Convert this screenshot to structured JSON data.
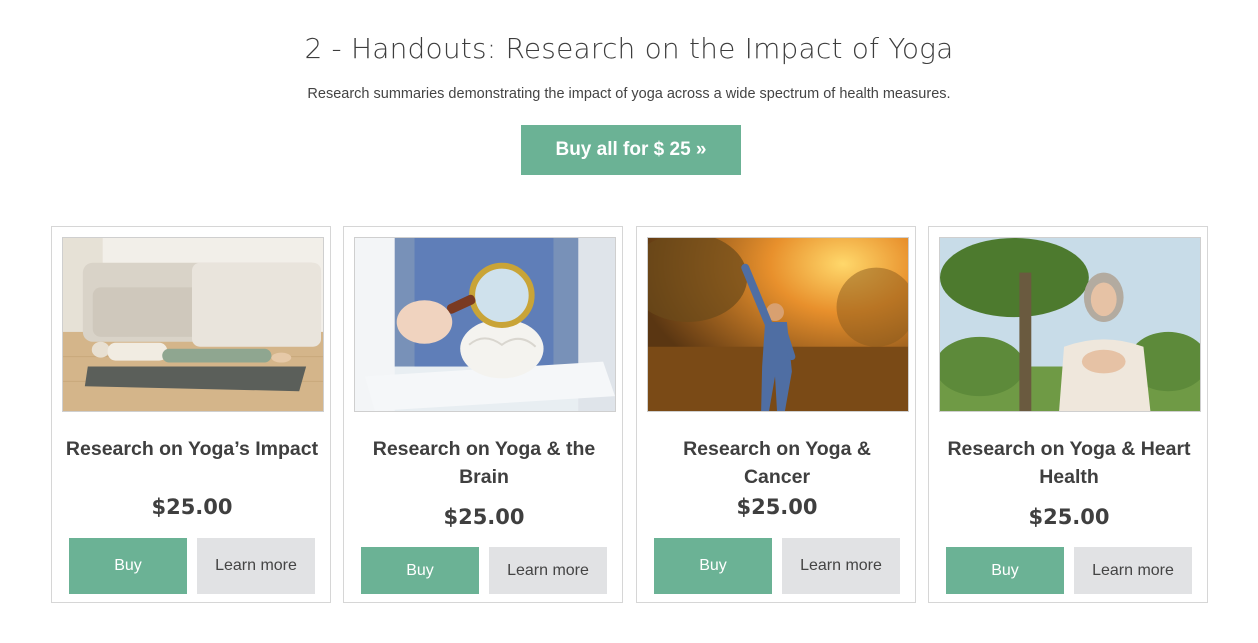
{
  "header": {
    "title": "2 - Handouts: Research on the Impact of Yoga",
    "subtitle": "Research summaries demonstrating the impact of yoga across a wide spectrum of health measures.",
    "buy_all_label": "Buy all for $ 25 »"
  },
  "products": [
    {
      "title": "Research on Yoga’s Impact",
      "price": "$25.00",
      "buy_label": "Buy",
      "learn_label": "Learn more",
      "image": "woman-lying-on-yoga-mat-photo"
    },
    {
      "title": "Research on Yoga & the Brain",
      "price": "$25.00",
      "buy_label": "Buy",
      "learn_label": "Learn more",
      "image": "magnifying-glass-over-brain-model-photo"
    },
    {
      "title": "Research on Yoga & Cancer",
      "price": "$25.00",
      "buy_label": "Buy",
      "learn_label": "Learn more",
      "image": "man-stretching-at-sunset-photo"
    },
    {
      "title": "Research on Yoga & Heart Health",
      "price": "$25.00",
      "buy_label": "Buy",
      "learn_label": "Learn more",
      "image": "woman-hands-on-chest-outdoors-photo"
    }
  ],
  "colors": {
    "accent": "#6bb295",
    "secondary_button": "#e1e2e4",
    "text": "#3f3f3f"
  }
}
